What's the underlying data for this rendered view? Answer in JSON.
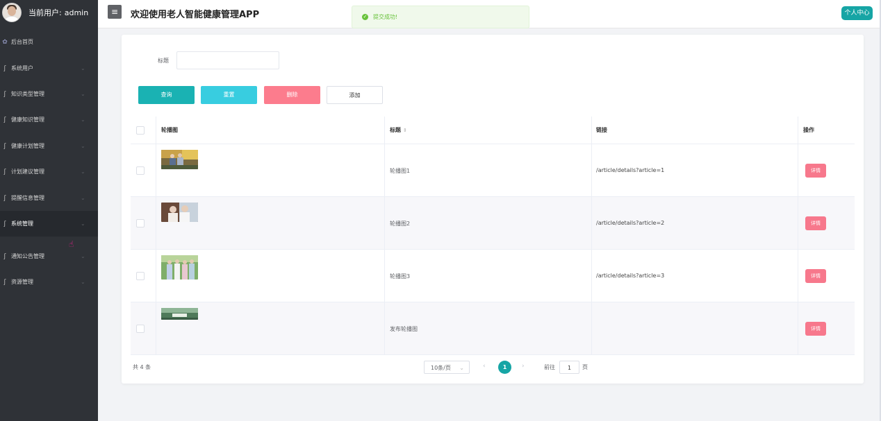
{
  "sidebar": {
    "current_user_label": "当前用户:",
    "current_user": "admin",
    "home_label": "后台首页",
    "items": [
      {
        "label": "系统用户"
      },
      {
        "label": "知识类型管理"
      },
      {
        "label": "健康知识管理"
      },
      {
        "label": "健康计划管理"
      },
      {
        "label": "计划建议管理"
      },
      {
        "label": "提醒信息管理"
      },
      {
        "label": "系统管理",
        "active": true
      },
      {
        "label": "通知公告管理"
      },
      {
        "label": "资源管理"
      }
    ]
  },
  "header": {
    "menu_icon": "hamburger-icon",
    "title": "欢迎使用老人智能健康管理APP",
    "profile_button": "个人中心"
  },
  "toast": {
    "text": "提交成功!",
    "color": "#67c23a"
  },
  "search": {
    "label": "标题",
    "value": ""
  },
  "actions": {
    "query": "查询",
    "reset": "重置",
    "delete": "删除",
    "add": "添加"
  },
  "table": {
    "columns": {
      "image": "轮播图",
      "title": "标题",
      "link": "链接",
      "operation": "操作"
    },
    "rows": [
      {
        "title": "轮播图1",
        "link": "/article/details?article=1",
        "action": "详情"
      },
      {
        "title": "轮播图2",
        "link": "/article/details?article=2",
        "action": "详情"
      },
      {
        "title": "轮播图3",
        "link": "/article/details?article=3",
        "action": "详情"
      },
      {
        "title": "发布轮播图",
        "link": "",
        "action": "详情"
      }
    ]
  },
  "pagination": {
    "total": "共 4 条",
    "page_size": "10条/页",
    "current_page": "1",
    "goto_label": "前往",
    "goto_value": "1",
    "page_unit": "页"
  },
  "colors": {
    "accent": "#16a5a5",
    "query": "#1ab2b3",
    "reset": "#38cde0",
    "delete": "#fc7c8d",
    "detail": "#f7788c",
    "sidebar": "#2f3237"
  }
}
